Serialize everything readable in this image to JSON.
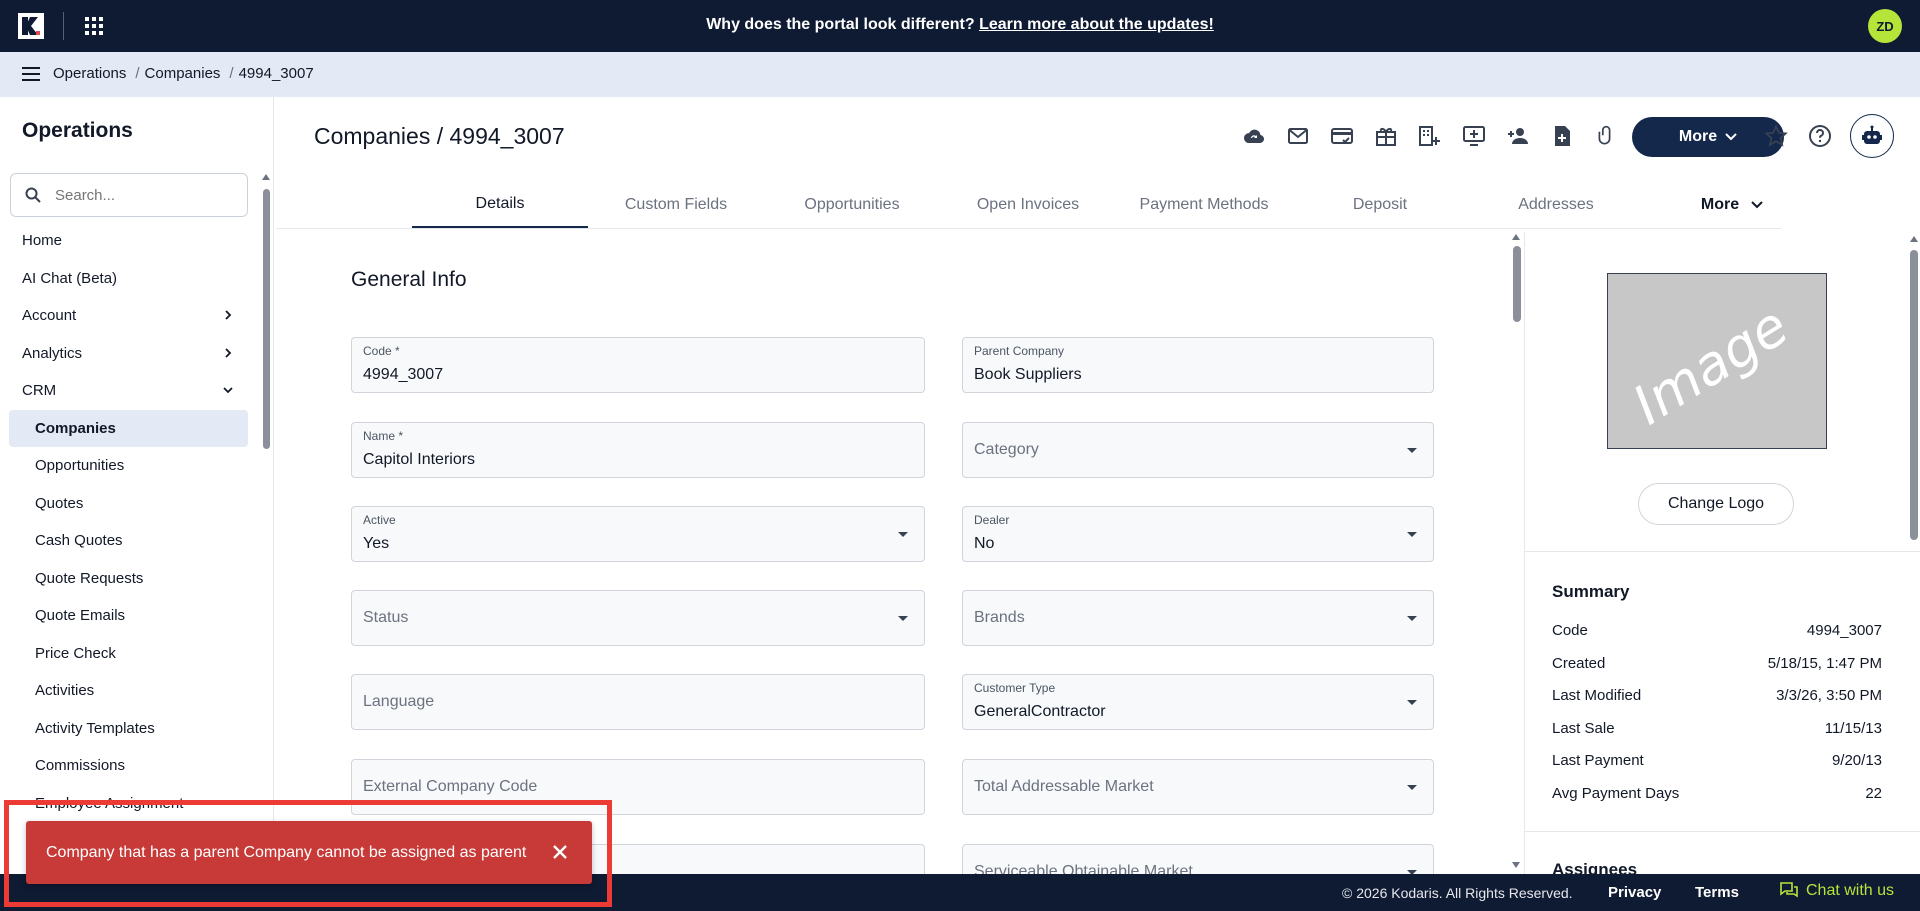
{
  "banner": {
    "text": "Why does the portal look different?",
    "link": "Learn more about the updates!",
    "user_initials": "ZD"
  },
  "breadcrumb": [
    "Operations",
    "Companies",
    "4994_3007"
  ],
  "sidebar": {
    "title": "Operations",
    "search_placeholder": "Search...",
    "items": [
      {
        "label": "Home",
        "type": "top"
      },
      {
        "label": "AI Chat (Beta)",
        "type": "top"
      },
      {
        "label": "Account",
        "type": "expandable-collapsed"
      },
      {
        "label": "Analytics",
        "type": "expandable-collapsed"
      },
      {
        "label": "CRM",
        "type": "expandable-open"
      },
      {
        "label": "Companies",
        "type": "sub-active"
      },
      {
        "label": "Opportunities",
        "type": "sub"
      },
      {
        "label": "Quotes",
        "type": "sub"
      },
      {
        "label": "Cash Quotes",
        "type": "sub"
      },
      {
        "label": "Quote Requests",
        "type": "sub"
      },
      {
        "label": "Quote Emails",
        "type": "sub"
      },
      {
        "label": "Price Check",
        "type": "sub"
      },
      {
        "label": "Activities",
        "type": "sub"
      },
      {
        "label": "Activity Templates",
        "type": "sub"
      },
      {
        "label": "Commissions",
        "type": "sub"
      },
      {
        "label": "Employee Assignment",
        "type": "sub"
      }
    ]
  },
  "page": {
    "title": "Companies / 4994_3007",
    "more_label": "More",
    "toolbar_icons": [
      "cloud-sync-icon",
      "mail-icon",
      "card-check-icon",
      "gift-icon",
      "building-add-icon",
      "add-to-screen-icon",
      "person-add-icon",
      "note-add-icon",
      "attachment-icon"
    ]
  },
  "tabs": [
    {
      "label": "Details",
      "active": true
    },
    {
      "label": "Custom Fields"
    },
    {
      "label": "Opportunities"
    },
    {
      "label": "Open Invoices"
    },
    {
      "label": "Payment Methods"
    },
    {
      "label": "Deposit"
    },
    {
      "label": "Addresses"
    },
    {
      "label": "More",
      "more": true
    }
  ],
  "form": {
    "section_title": "General Info",
    "code": {
      "label": "Code *",
      "value": "4994_3007"
    },
    "parent_company": {
      "label": "Parent Company",
      "value": "Book Suppliers"
    },
    "name": {
      "label": "Name *",
      "value": "Capitol Interiors"
    },
    "category": {
      "placeholder": "Category"
    },
    "active": {
      "label": "Active",
      "value": "Yes"
    },
    "dealer": {
      "label": "Dealer",
      "value": "No"
    },
    "status": {
      "placeholder": "Status"
    },
    "brands": {
      "placeholder": "Brands"
    },
    "language": {
      "placeholder": "Language"
    },
    "customer_type": {
      "label": "Customer Type",
      "value": "GeneralContractor"
    },
    "external_code": {
      "placeholder": "External Company Code"
    },
    "tam": {
      "placeholder": "Total Addressable Market"
    },
    "som": {
      "placeholder": "Serviceable Obtainable Market"
    }
  },
  "right": {
    "image_placeholder": "Image",
    "change_logo": "Change Logo",
    "summary_title": "Summary",
    "summary": [
      {
        "key": "Code",
        "value": "4994_3007"
      },
      {
        "key": "Created",
        "value": "5/18/15, 1:47 PM"
      },
      {
        "key": "Last Modified",
        "value": "3/3/26, 3:50 PM"
      },
      {
        "key": "Last Sale",
        "value": "11/15/13"
      },
      {
        "key": "Last Payment",
        "value": "9/20/13"
      },
      {
        "key": "Avg Payment Days",
        "value": "22"
      }
    ],
    "assignees_title": "Assignees"
  },
  "footer": {
    "copyright": "© 2026 Kodaris. All Rights Reserved.",
    "privacy": "Privacy",
    "terms": "Terms",
    "chat": "Chat with us"
  },
  "toast": {
    "message": "Company that has a parent Company cannot be assigned as parent"
  },
  "colors": {
    "navy": "#0f1a33",
    "accent_green": "#b6e53a",
    "error_red": "#c73a38"
  }
}
